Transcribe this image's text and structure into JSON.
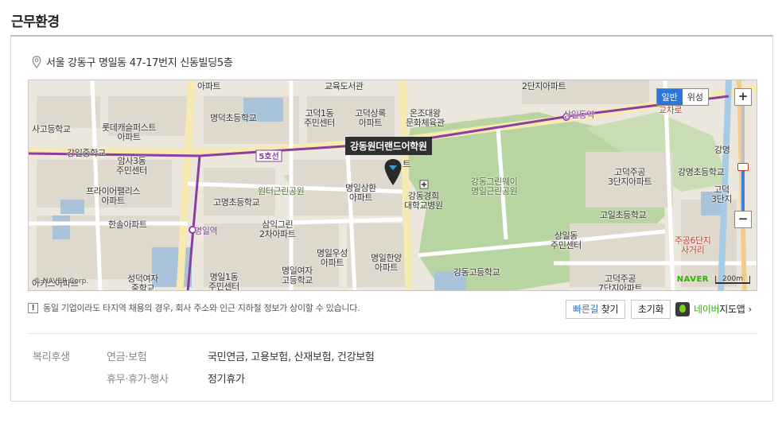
{
  "section": {
    "title": "근무환경"
  },
  "address": {
    "icon": "pin-icon",
    "text": "서울 강동구 명일동 47-17번지 신동빌딩5층"
  },
  "map": {
    "tooltip": "강동원더랜드어학원",
    "maptype": {
      "general": "일반",
      "satellite": "위성"
    },
    "zoom": {
      "in": "+",
      "out": "−",
      "level": 0.42
    },
    "logo": "NAVER",
    "scale": "200m",
    "copyright": "© NAVER Corp.",
    "line_label": "5호선",
    "labels": [
      {
        "text": "2단지아파트",
        "cls": ""
      },
      {
        "text": "상일동역",
        "cls": "purple"
      },
      {
        "text": "교차로",
        "cls": "red"
      },
      {
        "text": "사고등학교",
        "cls": ""
      },
      {
        "text": "롯데캐슬퍼스트\n아파트",
        "cls": ""
      },
      {
        "text": "명덕초등학교",
        "cls": ""
      },
      {
        "text": "고덕1동\n주민센터",
        "cls": ""
      },
      {
        "text": "고덕상록\n아파트",
        "cls": ""
      },
      {
        "text": "온조대왕\n문화체육관",
        "cls": ""
      },
      {
        "text": "강일중학교",
        "cls": ""
      },
      {
        "text": "암사3동\n주민센터",
        "cls": ""
      },
      {
        "text": "프라이어팰리스\n아파트",
        "cls": ""
      },
      {
        "text": "고명초등학교",
        "cls": ""
      },
      {
        "text": "원터근린공원",
        "cls": "green"
      },
      {
        "text": "명일삼환\n아파트",
        "cls": ""
      },
      {
        "text": "강동경희\n대학교병원",
        "cls": ""
      },
      {
        "text": "강동그린웨이\n명일근린공원",
        "cls": "green"
      },
      {
        "text": "고덕주공\n3단지아파트",
        "cls": ""
      },
      {
        "text": "강명초등학교",
        "cls": ""
      },
      {
        "text": "강명",
        "cls": ""
      },
      {
        "text": "고덕\n3단지",
        "cls": ""
      },
      {
        "text": "한솔아파트",
        "cls": ""
      },
      {
        "text": "명일역",
        "cls": "purple"
      },
      {
        "text": "삼익그린\n2차아파트",
        "cls": ""
      },
      {
        "text": "고일초등학교",
        "cls": ""
      },
      {
        "text": "상일동\n주민센터",
        "cls": ""
      },
      {
        "text": "주공6단지\n사거리",
        "cls": "red"
      },
      {
        "text": "명일우성\n아파트",
        "cls": ""
      },
      {
        "text": "명일한양\n아파트",
        "cls": ""
      },
      {
        "text": "성덕여자\n중학교",
        "cls": ""
      },
      {
        "text": "명일1동\n주민센터",
        "cls": ""
      },
      {
        "text": "명일여자\n고등학교",
        "cls": ""
      },
      {
        "text": "강동고등학교",
        "cls": ""
      },
      {
        "text": "고덕주공\n7단지아파트",
        "cls": ""
      },
      {
        "text": "아키스아파트",
        "cls": ""
      },
      {
        "text": "아파트",
        "cls": ""
      },
      {
        "text": "교육도서관",
        "cls": ""
      },
      {
        "text": "트",
        "cls": ""
      }
    ]
  },
  "notice": {
    "icon": "!",
    "text": "동일 기업이라도 타지역 채용의 경우, 회사 주소와 인근 지하철 정보가 상이할 수 있습니다."
  },
  "buttons": {
    "route_blue": "빠른길",
    "route_rest": " 찾기",
    "reset": "초기화",
    "naver_green": "네이버",
    "naver_rest": "지도앱",
    "chevron": "›"
  },
  "benefits": {
    "category": "복리후생",
    "rows": [
      {
        "key": "연금·보험",
        "value": "국민연금, 고용보험, 산재보험, 건강보험"
      },
      {
        "key": "휴무·휴가·행사",
        "value": "정기휴가"
      }
    ]
  }
}
